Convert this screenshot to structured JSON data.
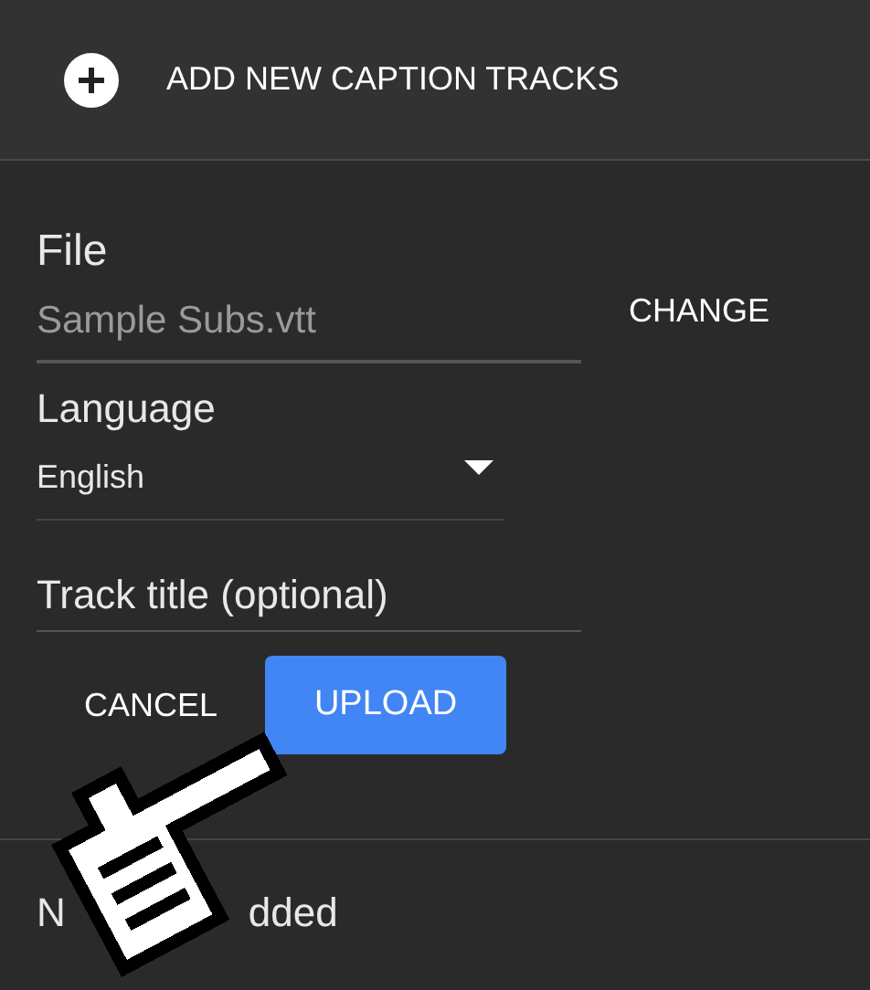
{
  "header": {
    "label": "ADD NEW CAPTION TRACKS"
  },
  "file": {
    "label": "File",
    "value": "Sample Subs.vtt",
    "change_button": "CHANGE"
  },
  "language": {
    "label": "Language",
    "value": "English"
  },
  "track_title": {
    "placeholder": "Track title (optional)"
  },
  "buttons": [
    {
      "label": "CANCEL",
      "kind": "text"
    },
    {
      "label": "UPLOAD",
      "kind": "primary"
    }
  ],
  "empty_message": {
    "visible_start": "N",
    "visible_end": "dded"
  }
}
